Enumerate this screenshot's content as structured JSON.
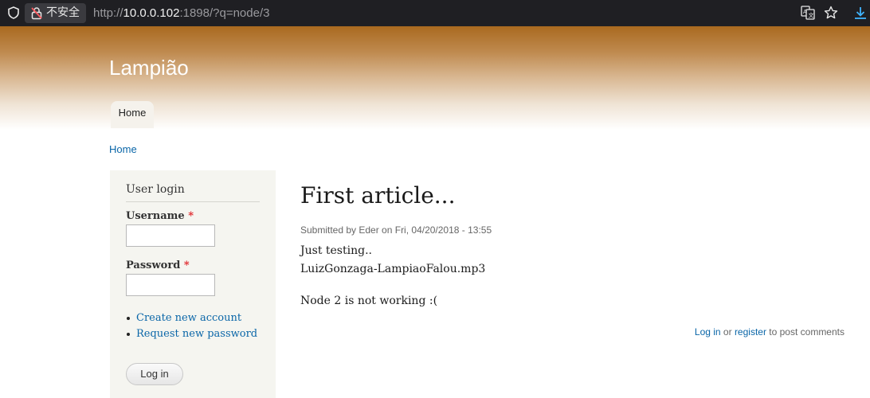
{
  "browser": {
    "security_label": "不安全",
    "url_prefix": "http://",
    "url_host": "10.0.0.102",
    "url_rest": ":1898/?q=node/3",
    "icons": [
      "shield-icon",
      "lock-warning-icon",
      "translate-icon",
      "star-icon",
      "download-icon"
    ]
  },
  "site": {
    "name": "Lampião",
    "menu": [
      {
        "label": "Home",
        "active": true
      }
    ]
  },
  "breadcrumb": {
    "label": "Home"
  },
  "sidebar": {
    "block_title": "User login",
    "username_label": "Username",
    "password_label": "Password",
    "required_marker": "*",
    "links": [
      {
        "label": "Create new account"
      },
      {
        "label": "Request new password"
      }
    ],
    "login_button": "Log in"
  },
  "article": {
    "title": "First article...",
    "submitted": "Submitted by Eder on Fri, 04/20/2018 - 13:55",
    "body": [
      "Just testing..",
      "LuizGonzaga-LampiaoFalou.mp3",
      "Node 2 is not working :("
    ],
    "comments": {
      "login_link": "Log in",
      "or_text": " or ",
      "register_link": "register",
      "suffix": " to post comments"
    }
  },
  "colors": {
    "header_top": "#a9691f",
    "link": "#0a66a8",
    "required": "#e0262b",
    "sidebar_bg": "#f5f5f0",
    "chrome_bg": "#1f1f23"
  }
}
